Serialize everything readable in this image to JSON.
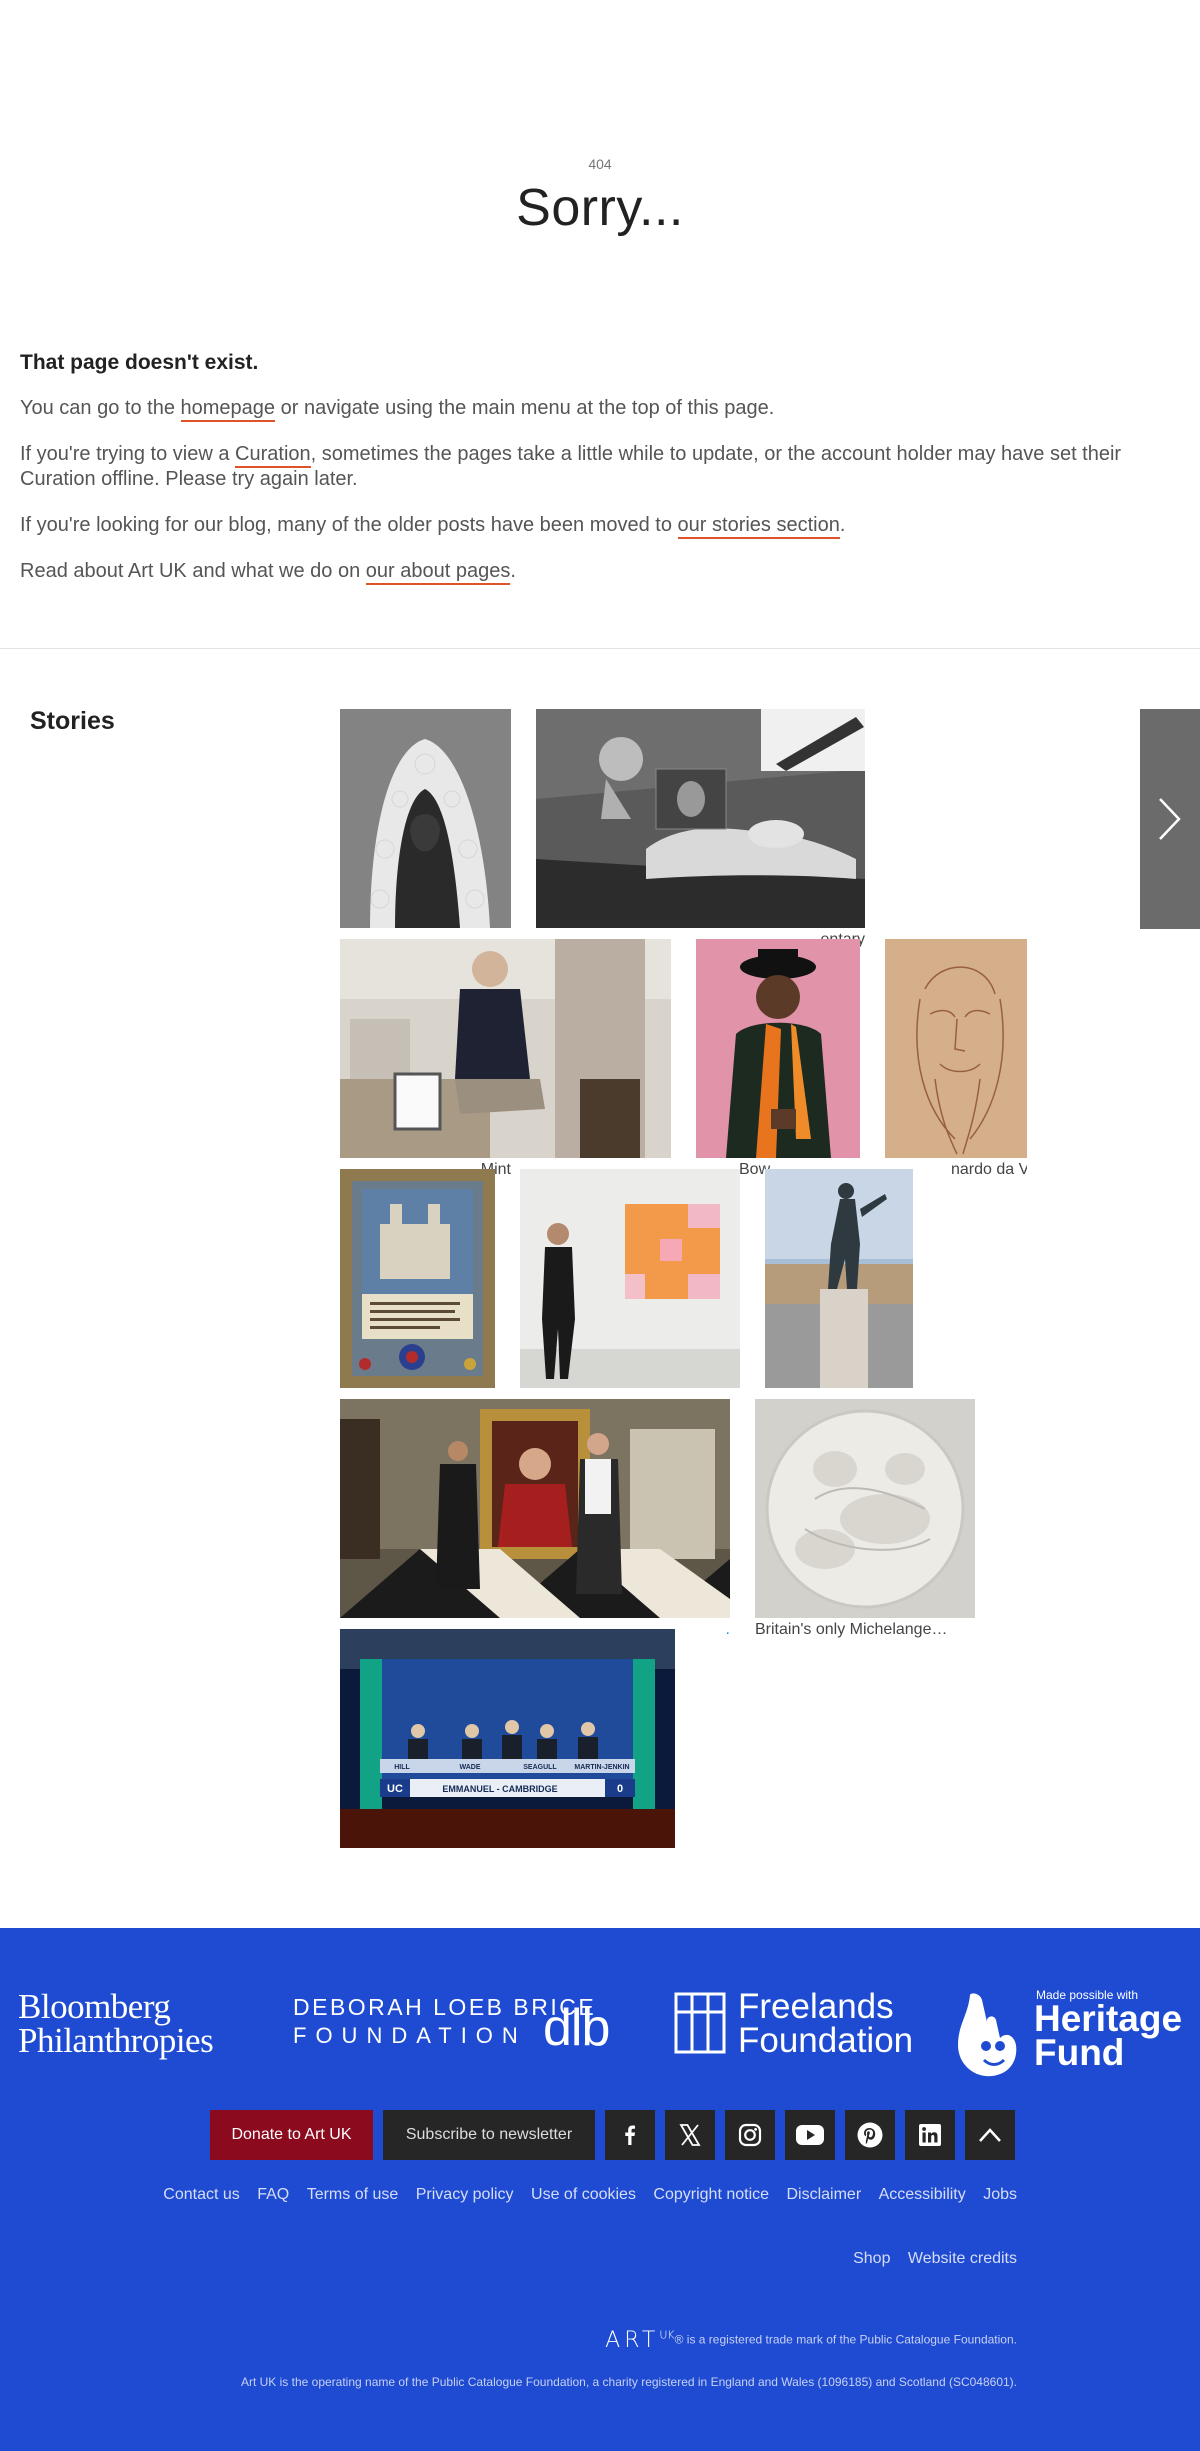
{
  "header": {
    "code": "404",
    "title": "Sorry..."
  },
  "message": {
    "heading": "That page doesn't exist.",
    "p1_before": "You can go to the ",
    "p1_link": "homepage",
    "p1_after": " or navigate using the main menu at the top of this page.",
    "p2_before": "If you're trying to view a ",
    "p2_link": "Curation",
    "p2_after": ", sometimes the pages take a little while to update, or the account holder may have set their Curation offline. Please try again later.",
    "p3_before": "If you're looking for our blog, many of the older posts have been moved to ",
    "p3_link": "our stories section",
    "p3_after": ".",
    "p4_before": "Read about Art UK and what we do on ",
    "p4_link": "our about pages",
    "p4_after": "."
  },
  "stories": {
    "heading": "Stories",
    "items": [
      {
        "caption": ""
      },
      {
        "caption": "entary"
      },
      {
        "caption": "Mint"
      },
      {
        "caption": "Bow"
      },
      {
        "caption": "nardo da Vi…"
      },
      {
        "caption": ""
      },
      {
        "caption": ""
      },
      {
        "caption": ""
      },
      {
        "caption": "."
      },
      {
        "caption": "Britain's only Michelange…"
      },
      {
        "caption": ""
      }
    ],
    "quiz_board": {
      "names": [
        "HILL",
        "WADE",
        "SEAGULL",
        "MARTIN-JENKIN"
      ],
      "team": "EMMANUEL - CAMBRIDGE",
      "logo": "UC",
      "score": "0"
    }
  },
  "footer": {
    "sponsors": {
      "bloomberg": [
        "Bloomberg",
        "Philanthropies"
      ],
      "dlb_line1": "DEBORAH LOEB BRICE",
      "dlb_line2": "FOUNDATION",
      "dlb_mark": "dlb",
      "freelands": [
        "Freelands",
        "Foundation"
      ],
      "heritage_small": "Made possible with",
      "heritage": [
        "Heritage",
        "Fund"
      ]
    },
    "donate_label": "Donate to Art UK",
    "subscribe_label": "Subscribe to newsletter",
    "social_icons": [
      "facebook-icon",
      "x-icon",
      "instagram-icon",
      "youtube-icon",
      "pinterest-icon",
      "linkedin-icon",
      "back-to-top-icon"
    ],
    "links_row1": [
      "Contact us",
      "FAQ",
      "Terms of use",
      "Privacy policy",
      "Use of cookies",
      "Copyright notice",
      "Disclaimer",
      "Accessibility",
      "Jobs"
    ],
    "links_row2": [
      "Shop",
      "Website credits"
    ],
    "logo_text": "ART",
    "logo_sup": "UK",
    "trademark": "® is a registered trade mark of the Public Catalogue Foundation.",
    "charity": "Art UK is the operating name of the Public Catalogue Foundation, a charity registered in England and Wales (1096185) and Scotland (SC048601).",
    "colors": {
      "background": "#1e4bd2",
      "donate": "#8b0a1e",
      "accent_underline": "#e0522b"
    }
  }
}
